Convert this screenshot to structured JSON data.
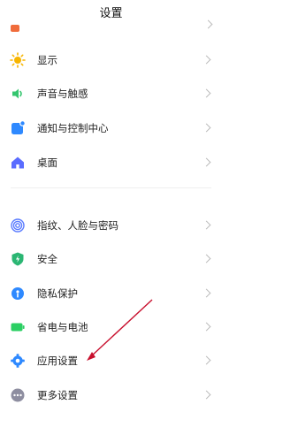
{
  "header": {
    "title": "设置"
  },
  "items": [
    {
      "label": "显示",
      "icon": "sun-icon",
      "color": "#f7b500"
    },
    {
      "label": "声音与触感",
      "icon": "speaker-icon",
      "color": "#36c66f"
    },
    {
      "label": "通知与控制中心",
      "icon": "notification-icon",
      "color": "#2e89ff"
    },
    {
      "label": "桌面",
      "icon": "home-icon",
      "color": "#5a6cff"
    },
    {
      "label": "指纹、人脸与密码",
      "icon": "fingerprint-icon",
      "color": "#5b7cff"
    },
    {
      "label": "安全",
      "icon": "shield-icon",
      "color": "#2bb673"
    },
    {
      "label": "隐私保护",
      "icon": "privacy-icon",
      "color": "#2e89ff"
    },
    {
      "label": "省电与电池",
      "icon": "battery-icon",
      "color": "#2bcf63"
    },
    {
      "label": "应用设置",
      "icon": "gear-icon",
      "color": "#2e89ff"
    },
    {
      "label": "更多设置",
      "icon": "more-icon",
      "color": "#8e8ea0"
    }
  ],
  "partial_top_item": {
    "icon": "partial-item-icon",
    "color": "#f06c3b"
  },
  "annotation": {
    "color": "#c8102e"
  }
}
